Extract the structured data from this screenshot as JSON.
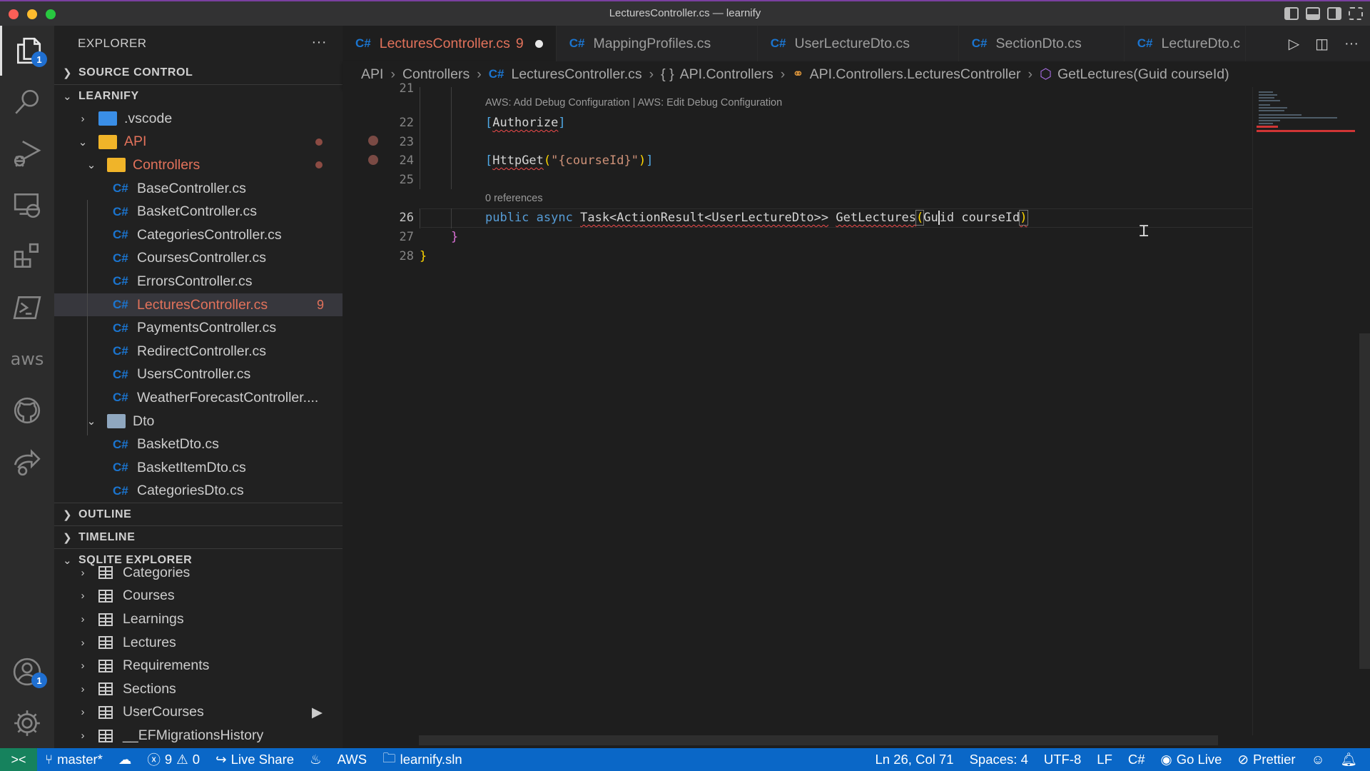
{
  "window": {
    "title": "LecturesController.cs — learnify"
  },
  "activity_bar": {
    "items": [
      {
        "name": "explorer",
        "badge": "1"
      },
      {
        "name": "search"
      },
      {
        "name": "run-debug"
      },
      {
        "name": "remote-explorer"
      },
      {
        "name": "extensions"
      },
      {
        "name": "powershell"
      },
      {
        "name": "aws",
        "label": "aws"
      },
      {
        "name": "github"
      },
      {
        "name": "live-share"
      }
    ],
    "accounts_badge": "1"
  },
  "sidebar": {
    "title": "EXPLORER",
    "more": "···",
    "source_control": "SOURCE CONTROL",
    "workspace": "LEARNIFY",
    "tree": {
      "vscode": ".vscode",
      "api": "API",
      "controllers": "Controllers",
      "controller_files": [
        {
          "name": "BaseController.cs"
        },
        {
          "name": "BasketController.cs"
        },
        {
          "name": "CategoriesController.cs"
        },
        {
          "name": "CoursesController.cs"
        },
        {
          "name": "ErrorsController.cs"
        },
        {
          "name": "LecturesController.cs",
          "errors": "9"
        },
        {
          "name": "PaymentsController.cs"
        },
        {
          "name": "RedirectController.cs"
        },
        {
          "name": "UsersController.cs"
        },
        {
          "name": "WeatherForecastController...."
        }
      ],
      "dto": "Dto",
      "dto_files": [
        {
          "name": "BasketDto.cs"
        },
        {
          "name": "BasketItemDto.cs"
        },
        {
          "name": "CategoriesDto.cs"
        }
      ]
    },
    "outline": "OUTLINE",
    "timeline": "TIMELINE",
    "sqlite_explorer": "SQLITE EXPLORER",
    "sqlite_tables": [
      "Categories",
      "Courses",
      "Learnings",
      "Lectures",
      "Requirements",
      "Sections",
      "UserCourses",
      "__EFMigrationsHistory"
    ]
  },
  "tabs": [
    {
      "label": "LecturesController.cs",
      "errors": "9",
      "active": true,
      "dirty": true
    },
    {
      "label": "MappingProfiles.cs"
    },
    {
      "label": "UserLectureDto.cs"
    },
    {
      "label": "SectionDto.cs"
    },
    {
      "label": "LectureDto.c"
    }
  ],
  "file_icon_label": "C#",
  "breadcrumb": [
    "API",
    "Controllers",
    "LecturesController.cs",
    "API.Controllers",
    "API.Controllers.LecturesController",
    "GetLectures(Guid courseId)"
  ],
  "editor": {
    "codelens_aws": "AWS: Add Debug Configuration | AWS: Edit Debug Configuration",
    "codelens_refs": "0 references",
    "line_numbers": [
      "21",
      "22",
      "23",
      "24",
      "25",
      "26",
      "27",
      "28"
    ],
    "code": {
      "l22_attr": "Authorize",
      "l24_attr": "HttpGet",
      "l24_str": "\"{courseId}\"",
      "l26_kw1": "public",
      "l26_kw2": "async",
      "l26_type": "Task<ActionResult<UserLectureDto>>",
      "l26_method": "GetLectures",
      "l26_param_a": "Gu",
      "l26_param_b": "id courseId",
      "brace_close_inner": "}",
      "brace_close_outer": "}"
    }
  },
  "status_bar": {
    "branch": "master*",
    "errors": "9",
    "warnings": "0",
    "live_share": "Live Share",
    "aws": "AWS",
    "solution": "learnify.sln",
    "cursor": "Ln 26, Col 71",
    "spaces": "Spaces: 4",
    "encoding": "UTF-8",
    "eol": "LF",
    "language": "C#",
    "go_live": "Go Live",
    "prettier": "Prettier"
  }
}
